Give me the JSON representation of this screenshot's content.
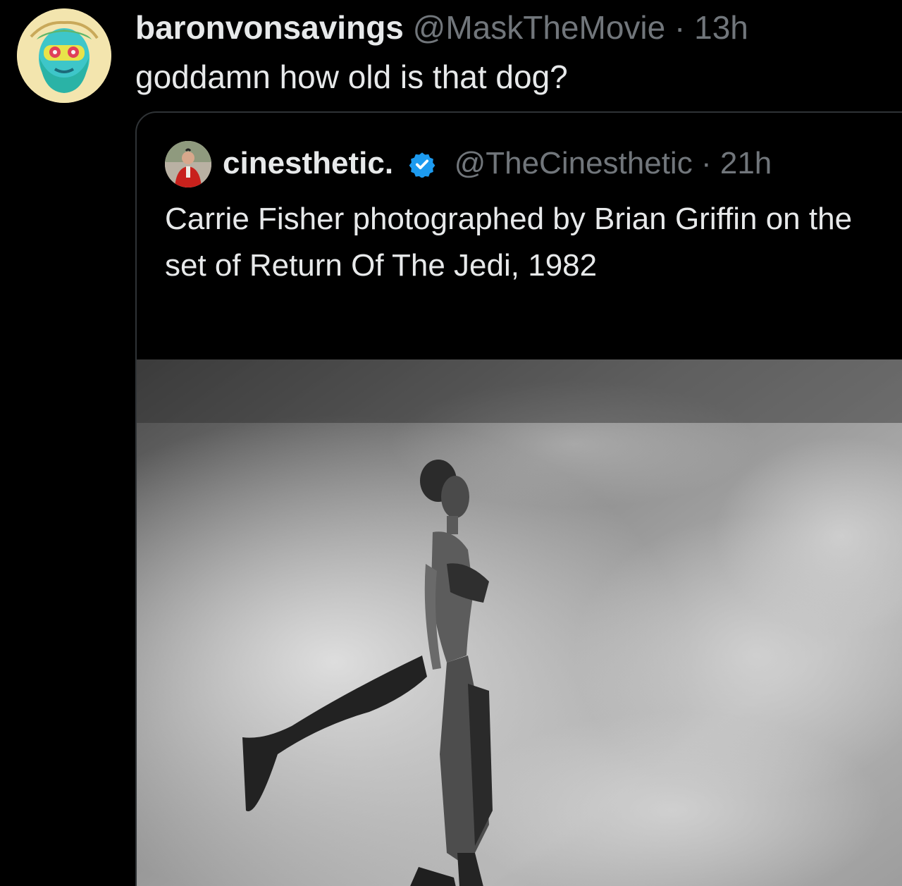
{
  "reply": {
    "display_name": "baronvonsavings",
    "handle": "@MaskTheMovie",
    "separator": "·",
    "time": "13h",
    "text": "goddamn how old is that dog?",
    "avatar_icon": "illustrated-bearded-face-avatar"
  },
  "quoted_post": {
    "display_name": "cinesthetic.",
    "verified": true,
    "verified_color": "#1d9bf0",
    "handle": "@TheCinesthetic",
    "separator": "·",
    "time": "21h",
    "text": "Carrie Fisher photographed by Brian Griffin on the set of Return Of The Jedi, 1982",
    "avatar_icon": "person-in-red-jacket-avatar",
    "media": {
      "type": "photo",
      "style": "black-and-white",
      "subject": "woman-standing-with-flowing-sash-against-cloudy-sky"
    }
  },
  "colors": {
    "background": "#000000",
    "primary_text": "#e7e9ea",
    "secondary_text": "#71767b",
    "card_border": "#2f3336"
  }
}
